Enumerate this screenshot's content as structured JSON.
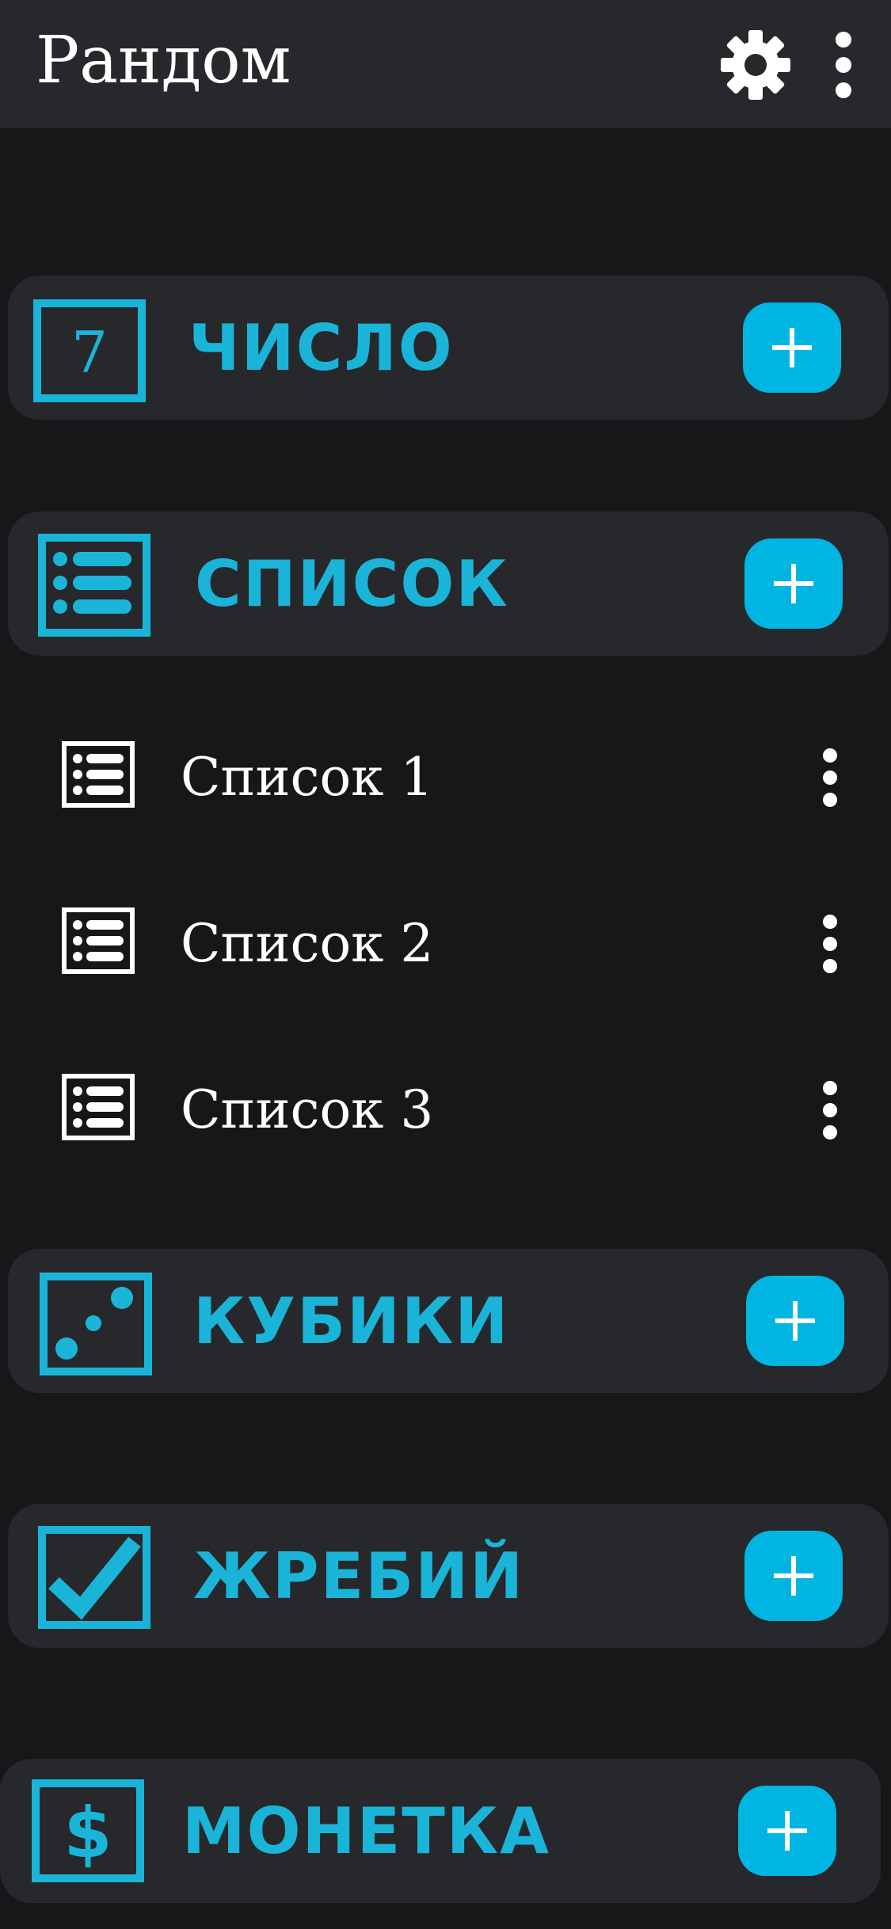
{
  "appbar": {
    "title": "Рандом",
    "settings_icon": "gear-icon",
    "menu_icon": "more-vert-icon"
  },
  "colors": {
    "accent": "#1bb4d9",
    "button": "#00b5e2",
    "card": "#26282b",
    "background": "#151718",
    "text": "#ffffff"
  },
  "sections": {
    "number": {
      "label": "ЧИСЛО",
      "icon_text": "7",
      "icon": "number-seven-icon",
      "add_icon": "plus-icon"
    },
    "list": {
      "label": "СПИСОК",
      "icon": "list-icon",
      "add_icon": "plus-icon"
    },
    "dice": {
      "label": "КУБИКИ",
      "icon": "dice-icon",
      "add_icon": "plus-icon"
    },
    "lots": {
      "label": "ЖРЕБИЙ",
      "icon": "checkmark-icon",
      "add_icon": "plus-icon"
    },
    "coin": {
      "label": "МОНЕТКА",
      "icon_text": "$",
      "icon": "dollar-icon",
      "add_icon": "plus-icon"
    }
  },
  "list_items": [
    {
      "label": "Список 1",
      "icon": "list-icon",
      "menu_icon": "more-vert-icon"
    },
    {
      "label": "Список 2",
      "icon": "list-icon",
      "menu_icon": "more-vert-icon"
    },
    {
      "label": "Список 3",
      "icon": "list-icon",
      "menu_icon": "more-vert-icon"
    }
  ]
}
